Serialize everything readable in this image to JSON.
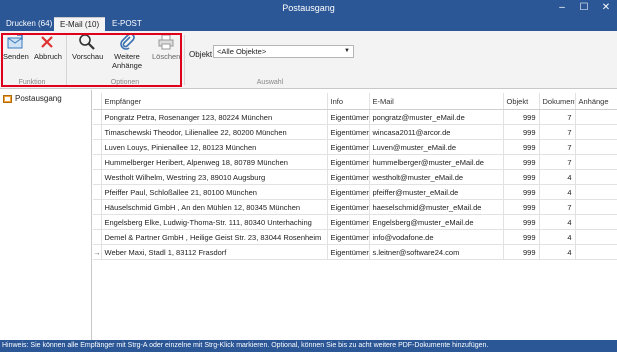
{
  "window": {
    "title": "Postausgang"
  },
  "tabs": [
    {
      "label": "Drucken (64)"
    },
    {
      "label": "E-Mail (10)"
    },
    {
      "label": "E-POST"
    }
  ],
  "ribbon": {
    "funktion": {
      "label": "Funktion",
      "senden": "Senden",
      "abbruch": "Abbruch"
    },
    "optionen": {
      "label": "Optionen",
      "vorschau": "Vorschau",
      "weitere_line1": "Weitere",
      "weitere_line2": "Anhänge",
      "loeschen": "Löschen"
    },
    "auswahl": {
      "label": "Auswahl",
      "objekt_label": "Objekt",
      "objekt_value": "<Alle Objekte>"
    }
  },
  "tree": {
    "item": "Postausgang"
  },
  "table": {
    "columns": [
      "Empfänger",
      "Info",
      "E-Mail",
      "Objekt",
      "Dokument",
      "Anhänge"
    ],
    "rows": [
      [
        "Pongratz Petra, Rosenanger 123, 80224 München",
        "Eigentümer",
        "pongratz@muster_eMail.de",
        "999",
        "7",
        ""
      ],
      [
        "Timaschewski Theodor, Lilienallee 22, 80200 München",
        "Eigentümer",
        "wincasa2011@arcor.de",
        "999",
        "7",
        ""
      ],
      [
        "Luven Louys, Pinienallee 12, 80123 München",
        "Eigentümer",
        "Luven@muster_eMail.de",
        "999",
        "7",
        ""
      ],
      [
        "Hummelberger Heribert, Alpenweg 18, 80789 München",
        "Eigentümer",
        "hummelberger@muster_eMail.de",
        "999",
        "7",
        ""
      ],
      [
        "Westholt Wilhelm, Westring 23, 89010 Augsburg",
        "Eigentümer",
        "westholt@muster_eMail.de",
        "999",
        "4",
        ""
      ],
      [
        "Pfeiffer Paul, Schloßallee 21, 80100 München",
        "Eigentümer",
        "pfeiffer@muster_eMail.de",
        "999",
        "4",
        ""
      ],
      [
        "Häuselschmid GmbH , An den Mühlen 12, 80345 München",
        "Eigentümer",
        "haeselschmid@muster_eMail.de",
        "999",
        "7",
        ""
      ],
      [
        "Engelsberg Elke, Ludwig-Thoma-Str. 111, 80340 Unterhaching",
        "Eigentümer",
        "Engelsberg@muster_eMail.de",
        "999",
        "4",
        ""
      ],
      [
        "Demel & Partner GmbH , Heilige Geist Str. 23, 83044 Rosenheim",
        "Eigentümer",
        "info@vodafone.de",
        "999",
        "4",
        ""
      ],
      [
        "Weber Maxi, Stadl 1, 83112 Frasdorf",
        "Eigentümer",
        "s.leitner@software24.com",
        "999",
        "4",
        ""
      ]
    ],
    "current_row_marker": "→"
  },
  "statusbar": {
    "text": "Hinweis: Sie können alle Empfänger mit Strg-A oder einzelne mit Strg-Klick markieren. Optional, können Sie bis zu acht weitere PDF-Dokumente hinzufügen."
  },
  "colors": {
    "titlebar": "#2b5797",
    "highlight": "#e0001b",
    "ribbon": "#f3f3f3"
  }
}
